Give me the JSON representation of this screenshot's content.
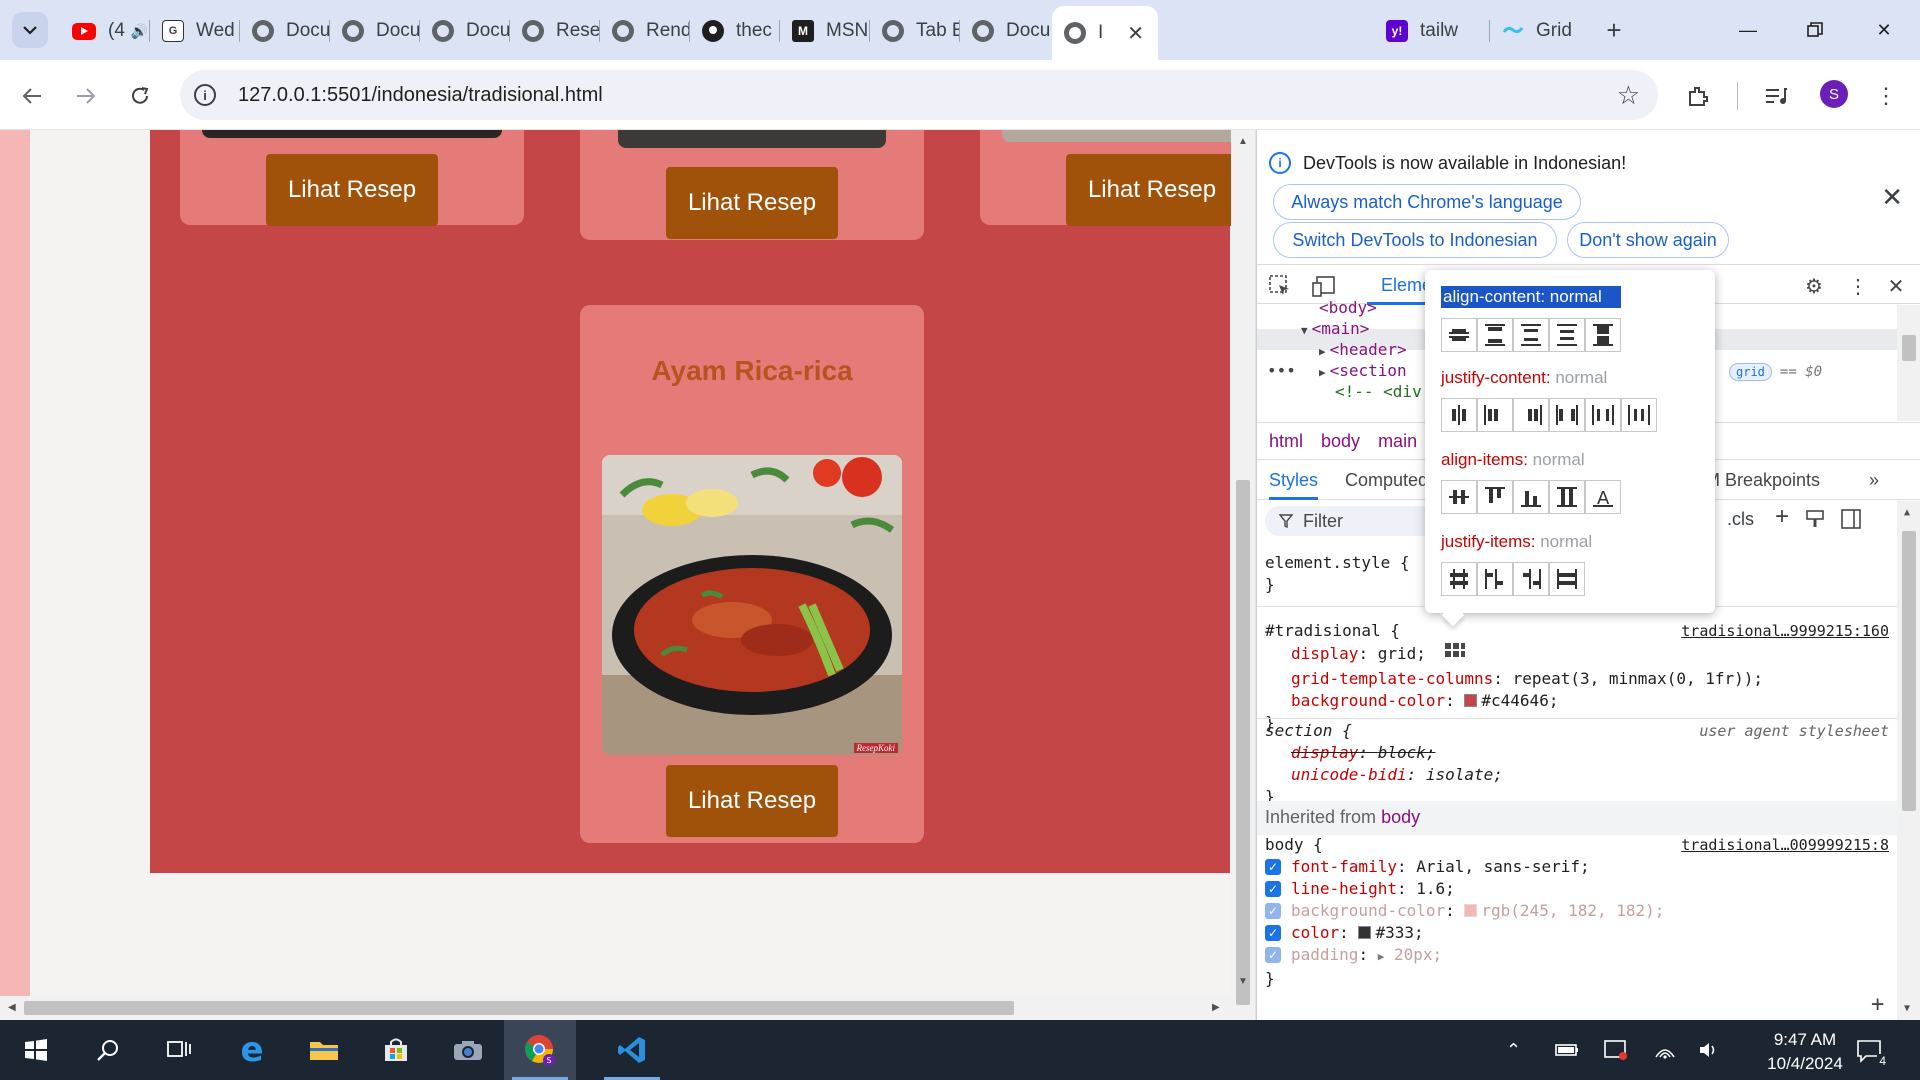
{
  "browser": {
    "tabs": [
      {
        "label": "(4",
        "icon": "youtube-icon"
      },
      {
        "label": "Wed",
        "icon": "wedding-site-icon"
      },
      {
        "label": "Docu",
        "icon": "globe-icon"
      },
      {
        "label": "Docu",
        "icon": "globe-icon"
      },
      {
        "label": "Docu",
        "icon": "globe-icon"
      },
      {
        "label": "Rese",
        "icon": "globe-icon"
      },
      {
        "label": "Rend",
        "icon": "globe-icon"
      },
      {
        "label": "thec",
        "icon": "github-icon"
      },
      {
        "label": "MSN",
        "icon": "msn-icon"
      },
      {
        "label": "Tab E",
        "icon": "globe-icon"
      },
      {
        "label": "Docu",
        "icon": "globe-icon"
      },
      {
        "label": "I",
        "icon": "globe-icon"
      },
      {
        "label": "tailw",
        "icon": "yahoo-icon"
      },
      {
        "label": "Grid",
        "icon": "tailwind-icon"
      }
    ],
    "url": "127.0.0.1:5501/indonesia/tradisional.html",
    "profile_initial": "S"
  },
  "page": {
    "cards": [
      {
        "button": "Lihat Resep"
      },
      {
        "button": "Lihat Resep"
      },
      {
        "button": "Lihat Resep"
      },
      {
        "title": "Ayam Rica-rica",
        "button": "Lihat Resep"
      }
    ],
    "watermark": "ResepKoki",
    "colors": {
      "section": "#c44646",
      "card": "#e57b79",
      "button": "#a0520a",
      "title": "#b5541e",
      "body": "#f5b6b6"
    }
  },
  "devtools": {
    "infobar": {
      "message": "DevTools is now available in Indonesian!",
      "btn_match": "Always match Chrome's language",
      "btn_switch": "Switch DevTools to Indonesian",
      "btn_dont": "Don't show again"
    },
    "tab_elements": "Eleme",
    "dom": {
      "line_body": "<body>",
      "line_main": "<main>",
      "line_header": "<header>",
      "line_section": "<section",
      "grid_badge": "grid",
      "eq0": "== $0",
      "line_comment": "<!-- <div"
    },
    "breadcrumbs": [
      "html",
      "body",
      "main"
    ],
    "styles_tabs": {
      "styles": "Styles",
      "computed": "Computed",
      "dom_breakpoints": "M Breakpoints"
    },
    "filter": "Filter",
    "cls": ".cls",
    "rules": {
      "element_style": "element.style {",
      "close": "}",
      "trad_selector": "#tradisional {",
      "trad_source": "tradisional…9999215:160",
      "trad_decls": [
        {
          "name": "display",
          "value": "grid;"
        },
        {
          "name": "grid-template-columns",
          "value": "repeat(3, minmax(0, 1fr));"
        },
        {
          "name": "background-color",
          "value": "#c44646;"
        }
      ],
      "section_selector": "section {",
      "section_source": "user agent stylesheet",
      "section_decls": [
        {
          "name": "display",
          "value": "block;"
        },
        {
          "name": "unicode-bidi",
          "value": "isolate;"
        }
      ],
      "inherited_label": "Inherited from",
      "inherited_from": "body",
      "body_selector": "body {",
      "body_source": "tradisional…009999215:8",
      "body_decls": [
        {
          "name": "font-family",
          "value": "Arial, sans-serif;"
        },
        {
          "name": "line-height",
          "value": "1.6;"
        },
        {
          "name": "background-color",
          "value": "rgb(245, 182, 182);"
        },
        {
          "name": "color",
          "value": "#333;"
        },
        {
          "name": "padding",
          "value": "20px;"
        }
      ]
    },
    "popover": {
      "align_content": {
        "name": "align-content",
        "value": "normal"
      },
      "justify_content": {
        "name": "justify-content",
        "value": "normal"
      },
      "align_items": {
        "name": "align-items",
        "value": "normal"
      },
      "justify_items": {
        "name": "justify-items",
        "value": "normal"
      }
    }
  },
  "taskbar": {
    "time": "9:47 AM",
    "date": "10/4/2024",
    "notifications": "4"
  }
}
